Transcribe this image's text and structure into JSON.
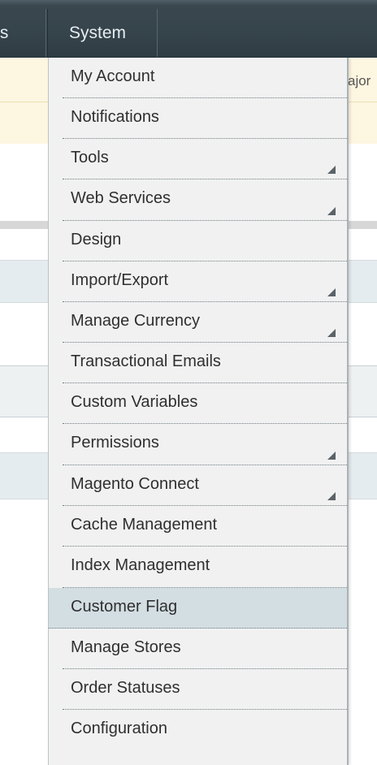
{
  "nav": {
    "partial_tab_label": "ts",
    "system_tab_label": "System"
  },
  "notice": {
    "partial_text": "ajor"
  },
  "menu": {
    "items": [
      {
        "label": "My Account",
        "has_submenu": false,
        "highlighted": false
      },
      {
        "label": "Notifications",
        "has_submenu": false,
        "highlighted": false
      },
      {
        "label": "Tools",
        "has_submenu": true,
        "highlighted": false
      },
      {
        "label": "Web Services",
        "has_submenu": true,
        "highlighted": false
      },
      {
        "label": "Design",
        "has_submenu": false,
        "highlighted": false
      },
      {
        "label": "Import/Export",
        "has_submenu": true,
        "highlighted": false
      },
      {
        "label": "Manage Currency",
        "has_submenu": true,
        "highlighted": false
      },
      {
        "label": "Transactional Emails",
        "has_submenu": false,
        "highlighted": false
      },
      {
        "label": "Custom Variables",
        "has_submenu": false,
        "highlighted": false
      },
      {
        "label": "Permissions",
        "has_submenu": true,
        "highlighted": false
      },
      {
        "label": "Magento Connect",
        "has_submenu": true,
        "highlighted": false
      },
      {
        "label": "Cache Management",
        "has_submenu": false,
        "highlighted": false
      },
      {
        "label": "Index Management",
        "has_submenu": false,
        "highlighted": false
      },
      {
        "label": "Customer Flag",
        "has_submenu": false,
        "highlighted": true
      },
      {
        "label": "Manage Stores",
        "has_submenu": false,
        "highlighted": false
      },
      {
        "label": "Order Statuses",
        "has_submenu": false,
        "highlighted": false
      },
      {
        "label": "Configuration",
        "has_submenu": false,
        "highlighted": false
      }
    ]
  },
  "colors": {
    "navbar": "#36444c",
    "menu_background": "#f1f1f1",
    "menu_highlight": "#d3dee3",
    "notice_background": "#fdf6e0"
  }
}
